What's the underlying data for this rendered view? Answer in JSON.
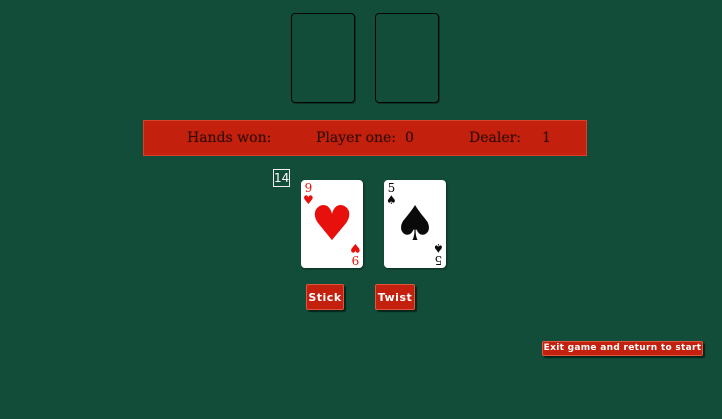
{
  "scoreboard": {
    "hands_won_label": "Hands won:",
    "player_label": "Player one:",
    "player_score": "0",
    "dealer_label": "Dealer:",
    "dealer_score": "1"
  },
  "player_hand": {
    "total": "14",
    "cards": [
      {
        "rank": "9",
        "suit": "♥",
        "suit_name": "hearts",
        "color": "red"
      },
      {
        "rank": "5",
        "suit": "♠",
        "suit_name": "spades",
        "color": "black"
      }
    ]
  },
  "buttons": {
    "stick": "Stick",
    "twist": "Twist",
    "exit": "Exit game and return to start"
  },
  "colors": {
    "table": "#124d3a",
    "accent": "#c3200d",
    "red_suit": "#e8100c"
  }
}
